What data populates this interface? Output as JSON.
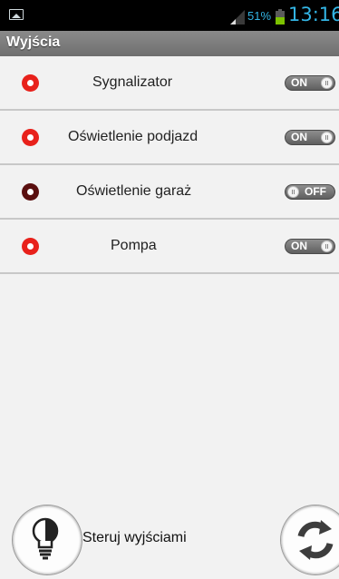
{
  "status_bar": {
    "battery_percent": "51%",
    "battery_level": 0.51,
    "time": "13:16",
    "icons": [
      "image-icon",
      "signal-icon",
      "battery-icon"
    ]
  },
  "title_bar": {
    "title": "Wyjścia"
  },
  "outputs": [
    {
      "label": "Sygnalizator",
      "state": "ON",
      "indicator_color": "#e8211b"
    },
    {
      "label": "Oświetlenie podjazd",
      "state": "ON",
      "indicator_color": "#e8211b"
    },
    {
      "label": "Oświetlenie garaż",
      "state": "OFF",
      "indicator_color": "#5a0f0f"
    },
    {
      "label": "Pompa",
      "state": "ON",
      "indicator_color": "#e8211b"
    }
  ],
  "bottom": {
    "control_label": "Steruj wyjściami",
    "icons": [
      "lightbulb-icon",
      "refresh-icon"
    ]
  },
  "colors": {
    "accent": "#33b5e5",
    "on_indicator": "#e8211b",
    "off_indicator": "#5a0f0f"
  }
}
